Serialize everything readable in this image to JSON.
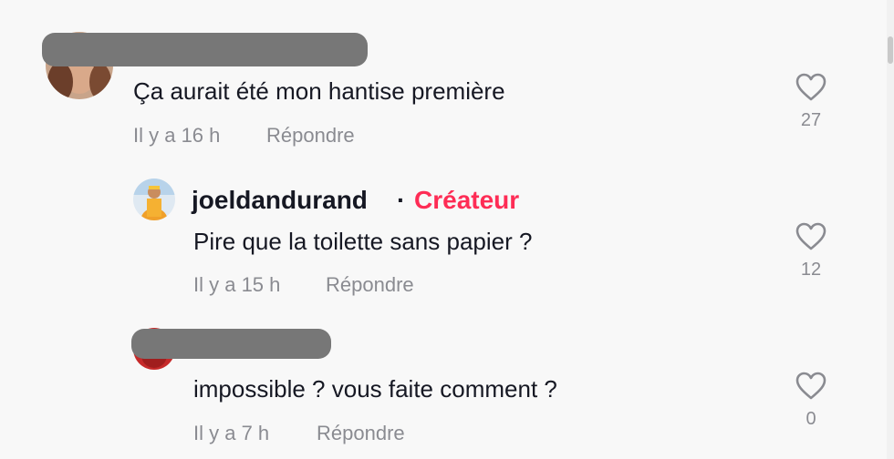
{
  "colors": {
    "creator_accent": "#fe2c55",
    "meta_text": "#8a8b91",
    "redaction": "#777777"
  },
  "comments": [
    {
      "text": "Ça aurait été mon hantise première",
      "time": "Il y a 16 h",
      "reply_label": "Répondre",
      "like_count": "27",
      "like_icon": "heart-outline-icon"
    },
    {
      "username": "joeldandurand",
      "separator": "·",
      "badge": "Créateur",
      "text": "Pire que la toilette sans papier ?",
      "time": "Il y a 15 h",
      "reply_label": "Répondre",
      "like_count": "12",
      "like_icon": "heart-outline-icon"
    },
    {
      "text": "impossible ? vous faite comment ?",
      "time": "Il y a 7 h",
      "reply_label": "Répondre",
      "like_count": "0",
      "like_icon": "heart-outline-icon"
    }
  ]
}
